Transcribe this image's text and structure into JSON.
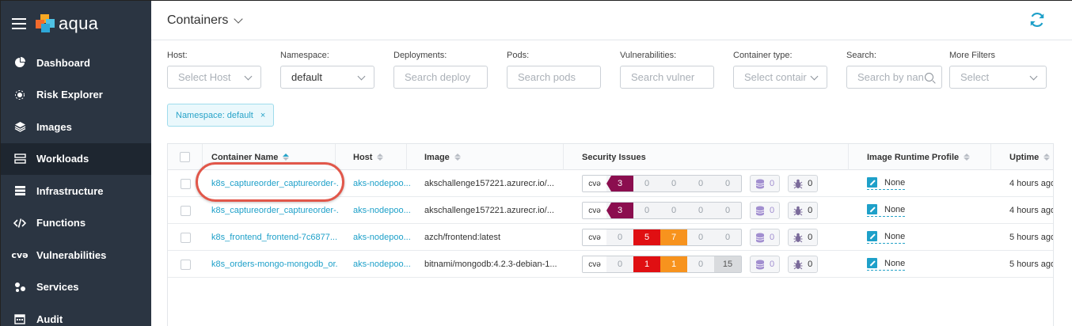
{
  "app": {
    "brand": "aqua"
  },
  "sidebar": {
    "items": [
      {
        "label": "Dashboard",
        "icon": "dashboard-icon"
      },
      {
        "label": "Risk Explorer",
        "icon": "risk-explorer-icon"
      },
      {
        "label": "Images",
        "icon": "layers-icon"
      },
      {
        "label": "Workloads",
        "icon": "workloads-icon",
        "active": true
      },
      {
        "label": "Infrastructure",
        "icon": "infrastructure-icon"
      },
      {
        "label": "Functions",
        "icon": "code-icon"
      },
      {
        "label": "Vulnerabilities",
        "icon": "cve-icon",
        "icon_text": "cvə"
      },
      {
        "label": "Services",
        "icon": "services-icon"
      },
      {
        "label": "Audit",
        "icon": "calendar-icon"
      }
    ]
  },
  "header": {
    "title": "Containers"
  },
  "filters": {
    "host": {
      "label": "Host:",
      "placeholder": "Select Host"
    },
    "namespace": {
      "label": "Namespace:",
      "value": "default"
    },
    "deployments": {
      "label": "Deployments:",
      "placeholder": "Search deploy"
    },
    "pods": {
      "label": "Pods:",
      "placeholder": "Search pods"
    },
    "vulnerabilities": {
      "label": "Vulnerabilities:",
      "placeholder": "Search vulner"
    },
    "container_type": {
      "label": "Container type:",
      "placeholder": "Select contair"
    },
    "search": {
      "label": "Search:",
      "placeholder": "Search by nan"
    },
    "more_filters": {
      "label": "More Filters",
      "placeholder": "Select"
    }
  },
  "active_filter": {
    "label": "Namespace: default",
    "remove": "×"
  },
  "table": {
    "columns": {
      "name": "Container Name",
      "host": "Host",
      "image": "Image",
      "security": "Security Issues",
      "runtime": "Image Runtime Profile",
      "uptime": "Uptime"
    },
    "cve_label": "cvə",
    "rows": [
      {
        "name": "k8s_captureorder_captureorder-...",
        "host": "aks-nodepoo...",
        "image": "akschallenge157221.azurecr.io/...",
        "cve": [
          "3",
          "0",
          "0",
          "0",
          "0"
        ],
        "sev": [
          "crit",
          "none",
          "none",
          "none",
          "none"
        ],
        "malware": "0",
        "sensitive": "0",
        "runtime": "None",
        "uptime": "4 hours ago"
      },
      {
        "name": "k8s_captureorder_captureorder-...",
        "host": "aks-nodepoo...",
        "image": "akschallenge157221.azurecr.io/...",
        "cve": [
          "3",
          "0",
          "0",
          "0",
          "0"
        ],
        "sev": [
          "crit",
          "none",
          "none",
          "none",
          "none"
        ],
        "malware": "0",
        "sensitive": "0",
        "runtime": "None",
        "uptime": "4 hours ago"
      },
      {
        "name": "k8s_frontend_frontend-7c6877...",
        "host": "aks-nodepoo...",
        "image": "azch/frontend:latest",
        "cve": [
          "0",
          "5",
          "7",
          "0",
          "0"
        ],
        "sev": [
          "none",
          "high",
          "med",
          "none",
          "none"
        ],
        "malware": "0",
        "sensitive": "0",
        "runtime": "None",
        "uptime": "5 hours ago"
      },
      {
        "name": "k8s_orders-mongo-mongodb_or...",
        "host": "aks-nodepoo...",
        "image": "bitnami/mongodb:4.2.3-debian-1...",
        "cve": [
          "0",
          "1",
          "1",
          "0",
          "15"
        ],
        "sev": [
          "none",
          "high",
          "med",
          "none",
          "neg"
        ],
        "malware": "0",
        "sensitive": "0",
        "runtime": "None",
        "uptime": "5 hours ago"
      }
    ]
  },
  "colors": {
    "sidebar_bg": "#2b3542",
    "accent": "#1ea0c9",
    "critical": "#8b0e4f",
    "high": "#e00f12",
    "medium": "#f7931e",
    "negligible": "#d9dbde",
    "highlight": "#e1574a"
  }
}
